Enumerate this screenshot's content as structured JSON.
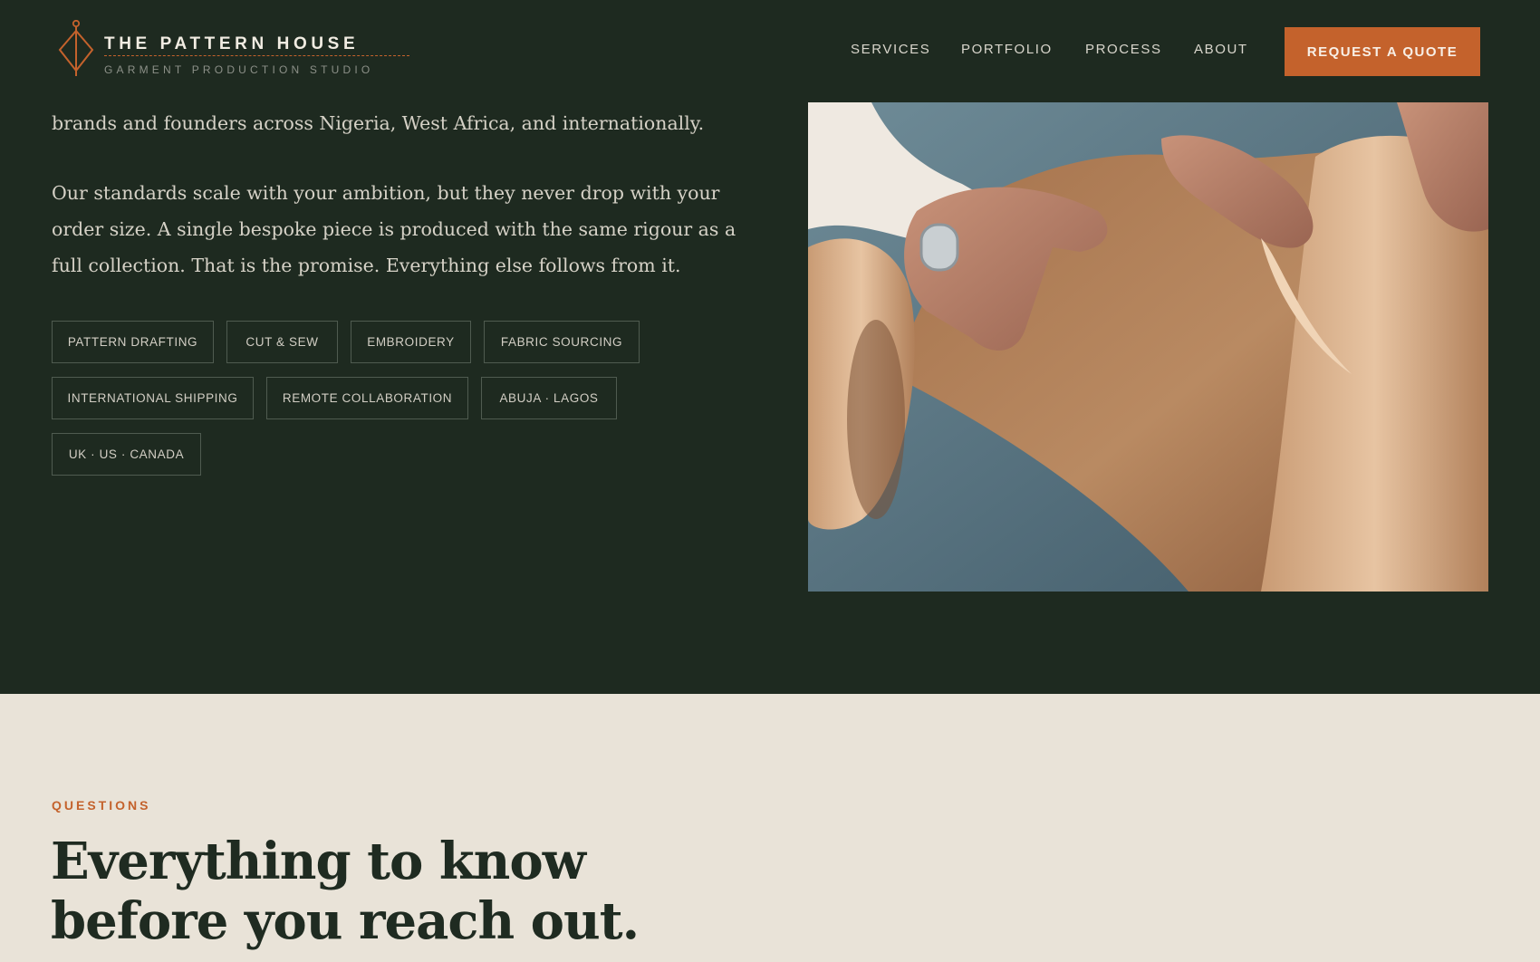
{
  "brand": {
    "name": "THE PATTERN HOUSE",
    "tagline": "GARMENT PRODUCTION STUDIO",
    "accent_color": "#c4622c",
    "mark_icon": "needle-diamond-icon"
  },
  "nav": {
    "links": [
      "SERVICES",
      "PORTFOLIO",
      "PROCESS",
      "ABOUT"
    ],
    "cta_label": "REQUEST A QUOTE"
  },
  "intro": {
    "paragraph_1": "brands and founders across Nigeria, West Africa, and internationally.",
    "paragraph_2": "Our standards scale with your ambition, but they never drop with your order size. A single bespoke piece is produced with the same rigour as a full collection. That is the promise. Everything else follows from it.",
    "tags": [
      "PATTERN DRAFTING",
      "CUT & SEW",
      "EMBROIDERY",
      "FABRIC SOURCING",
      "INTERNATIONAL SHIPPING",
      "REMOTE COLLABORATION",
      "ABUJA · LAGOS",
      "UK · US · CANADA"
    ]
  },
  "photo": {
    "icon": "hands-on-leather-photo"
  },
  "faq": {
    "eyebrow": "QUESTIONS",
    "heading_line_1": "Everything to know",
    "heading_line_2": "before you reach out."
  },
  "colors": {
    "dark_bg": "#1e2a20",
    "light_bg": "#e9e3d8",
    "accent": "#c4622c"
  }
}
